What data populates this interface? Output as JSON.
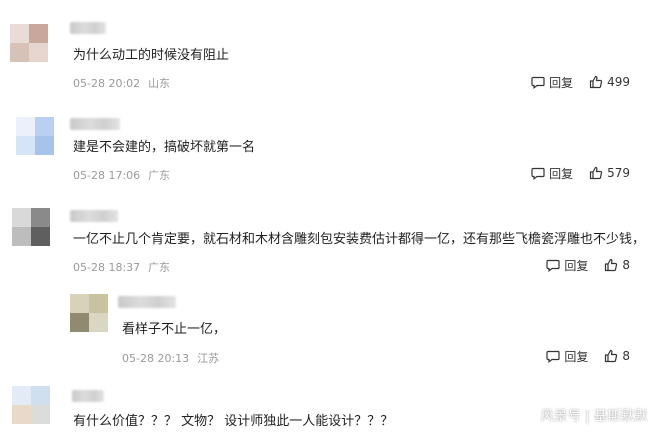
{
  "comments": [
    {
      "text": "为什么动工的时候没有阻止",
      "date": "05-28 20:02",
      "location": "山东",
      "reply_label": "回复",
      "likes": "499"
    },
    {
      "text": "建是不会建的，搞破坏就第一名",
      "date": "05-28 17:06",
      "location": "广东",
      "reply_label": "回复",
      "likes": "579"
    },
    {
      "text": "一亿不止几个肯定要，就石材和木材含雕刻包安装费估计都得一亿，还有那些飞檐瓷浮雕也不少钱，",
      "date": "05-28 18:37",
      "location": "广东",
      "reply_label": "回复",
      "likes": "8"
    },
    {
      "text": "看样子不止一亿，",
      "date": "05-28 20:13",
      "location": "江苏",
      "reply_label": "回复",
      "likes": "8"
    },
    {
      "text": "有什么价值？？？ 文物？ 设计师独此一人能设计？？？"
    }
  ],
  "watermark": {
    "source": "风景号",
    "author": "基斯默默"
  },
  "icons": {
    "reply": "comment-bubble-icon",
    "like": "thumbs-up-icon"
  },
  "colors": {
    "meta": "#9a9a9a",
    "text": "#1f1f1f"
  }
}
